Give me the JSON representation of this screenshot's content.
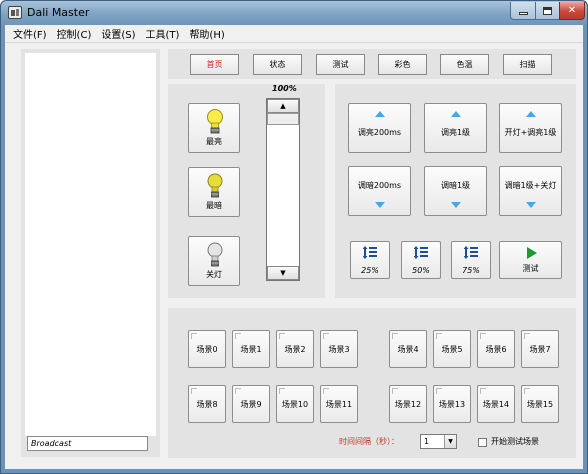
{
  "window": {
    "title": "Dali Master",
    "close_glyph": "✕"
  },
  "menu": [
    {
      "label": "文件(F)"
    },
    {
      "label": "控制(C)"
    },
    {
      "label": "设置(S)"
    },
    {
      "label": "工具(T)"
    },
    {
      "label": "帮助(H)"
    }
  ],
  "broadcast_value": "Broadcast",
  "nav": {
    "home": "首页",
    "status": "状态",
    "test": "测试",
    "color": "彩色",
    "color_temp": "色温",
    "scan": "扫描"
  },
  "control": {
    "brightest": "最亮",
    "darkest": "最暗",
    "off": "关灯",
    "level_percent": "100%",
    "level_value": 1.0
  },
  "dim": {
    "up_200ms": "调亮200ms",
    "up_1": "调亮1级",
    "on_up_1": "开灯+调亮1级",
    "down_200ms": "调暗200ms",
    "down_1": "调暗1级",
    "down_1_off": "调暗1级+关灯",
    "p25": "25%",
    "p50": "50%",
    "p75": "75%",
    "test": "测试"
  },
  "scenes": [
    "场景0",
    "场景1",
    "场景2",
    "场景3",
    "场景4",
    "场景5",
    "场景6",
    "场景7",
    "场景8",
    "场景9",
    "场景10",
    "场景11",
    "场景12",
    "场景13",
    "场景14",
    "场景15"
  ],
  "interval": {
    "label": "时间间隔（秒）：",
    "value": "1",
    "dropdown_glyph": "▼",
    "start_test_label": "开始测试场景"
  },
  "colors": {
    "accent_red": "#d2261b",
    "arrow_blue": "#4aa6e2",
    "play_green": "#1c9c2f",
    "title_bar": "#7ea3c3"
  },
  "icons": [
    "app-icon",
    "minimize-icon",
    "maximize-icon",
    "close-icon",
    "bulb-on-icon",
    "bulb-dim-icon",
    "bulb-off-icon",
    "arrow-up-icon",
    "arrow-down-icon",
    "level-icon",
    "play-icon",
    "dropdown-arrow-icon"
  ]
}
